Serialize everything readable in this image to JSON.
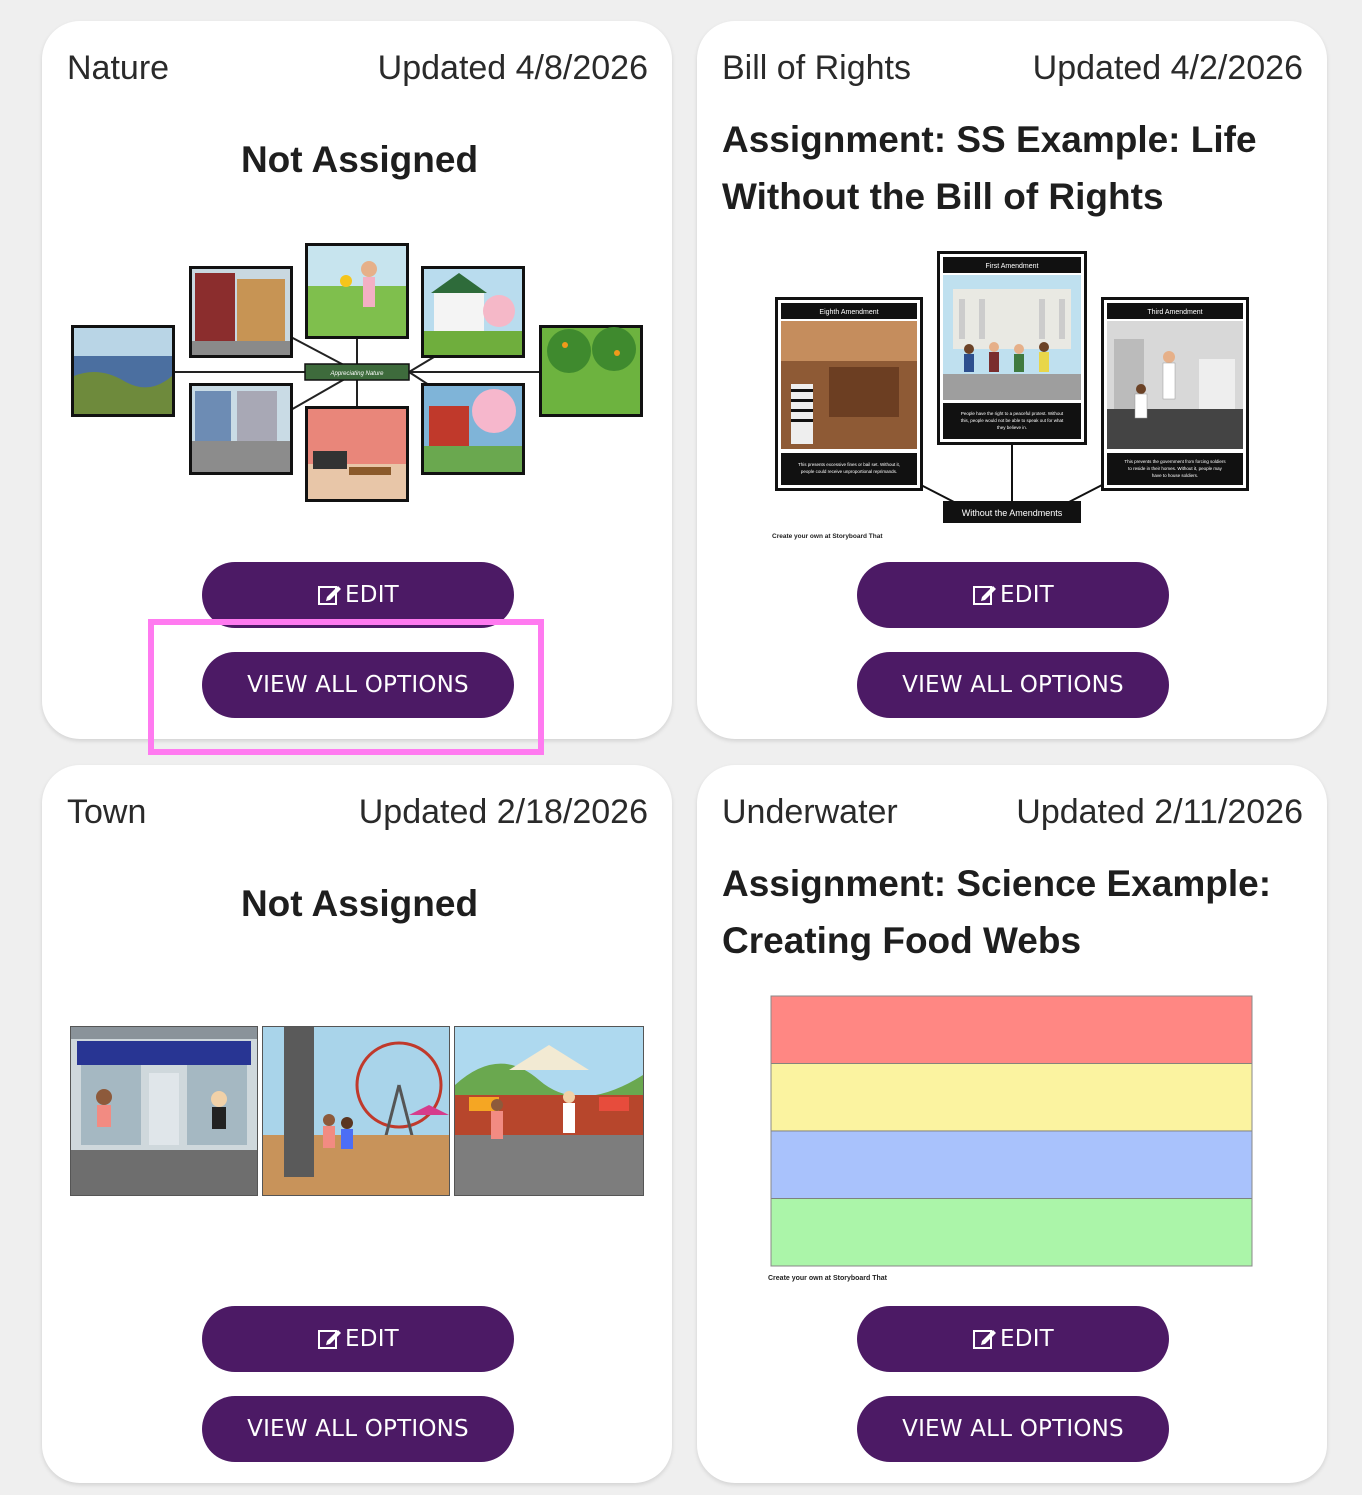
{
  "cards": [
    {
      "category": "Nature",
      "updated": "Updated 4/8/2026",
      "status_title": "Not Assigned",
      "diagram_center_label": "Appreciating Nature",
      "edit_label": "EDIT",
      "view_label": "VIEW ALL OPTIONS"
    },
    {
      "category": "Bill of Rights",
      "updated": "Updated 4/2/2026",
      "status_title": "Assignment: SS Example: Life Without the Bill of Rights",
      "panels": [
        {
          "heading": "Eighth Amendment",
          "caption": "This prevents excessive fines or bail set. Without it, people could receive unproportional reprimands."
        },
        {
          "heading": "First Amendment",
          "caption": "People have the right to a peaceful protest. Without this, people would not be able to speak out for what they believe in."
        },
        {
          "heading": "Third Amendment",
          "caption": "This prevents the government from forcing soldiers to reside in their homes. Without it, people may have to house soldiers."
        }
      ],
      "center_label": "Without the Amendments",
      "credit": "Create your own at Storyboard That",
      "edit_label": "EDIT",
      "view_label": "VIEW ALL OPTIONS"
    },
    {
      "category": "Town",
      "updated": "Updated 2/18/2026",
      "status_title": "Not Assigned",
      "edit_label": "EDIT",
      "view_label": "VIEW ALL OPTIONS"
    },
    {
      "category": "Underwater",
      "updated": "Updated 2/11/2026",
      "status_title": "Assignment: Science Example: Creating Food Webs",
      "band_colors": [
        "#ff8783",
        "#fbf3a0",
        "#a9c2fc",
        "#abf5a9"
      ],
      "credit": "Create your own at Storyboard That",
      "edit_label": "EDIT",
      "view_label": "VIEW ALL OPTIONS"
    }
  ],
  "colors": {
    "button": "#4c1a65",
    "highlight": "#ff7af0",
    "background": "#efefef"
  }
}
